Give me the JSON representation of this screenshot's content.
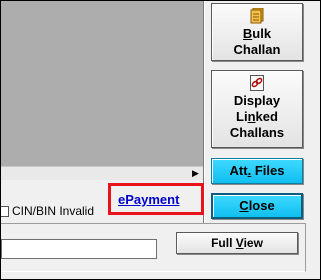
{
  "buttons": {
    "bulk_challan": {
      "line1": "Bulk",
      "line1_accel": "B",
      "line1_rest": "ulk",
      "line2": "Challan"
    },
    "display_linked": {
      "line1": "Display",
      "line2_pre": "Li",
      "line2_accel": "n",
      "line2_post": "ked",
      "line3": "Challans"
    },
    "att_files": {
      "pre": "Att",
      "accel": ".",
      "post": " Files"
    },
    "close": {
      "accel": "C",
      "rest": "lose"
    },
    "full_view": {
      "pre": "Full ",
      "accel": "V",
      "post": "iew"
    }
  },
  "checkbox": {
    "label": "CIN/BIN Invalid"
  },
  "epayment": {
    "label": "ePayment"
  },
  "colors": {
    "highlight_border": "#e8141c",
    "cyan_button": "#10bff0",
    "link": "#0000cc"
  },
  "icons": {
    "bulk": "document-stack-icon",
    "linked": "linked-challan-icon",
    "scroll": "scroll-right-arrow-icon"
  }
}
